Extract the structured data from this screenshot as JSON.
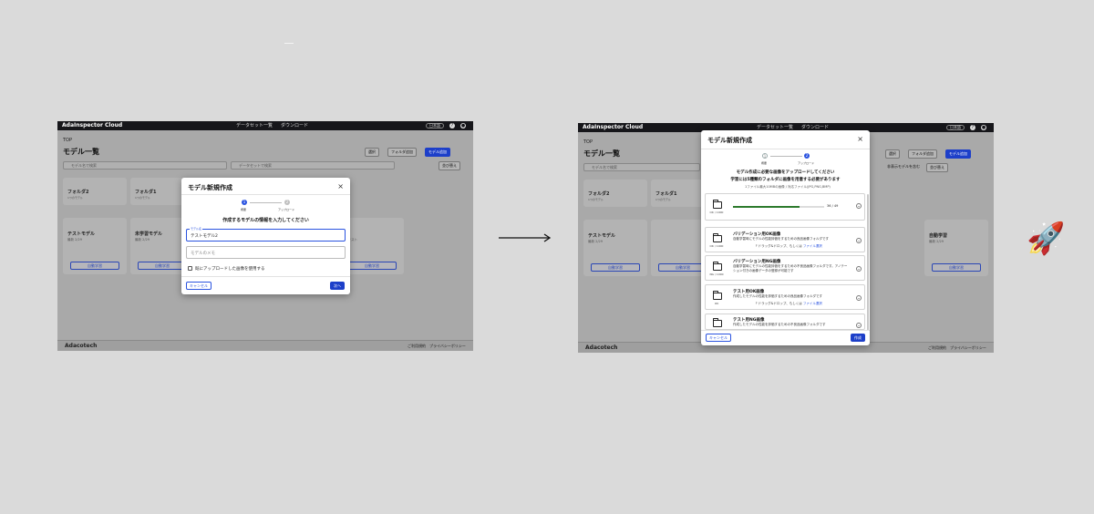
{
  "app": {
    "brand": "AdaInspector Cloud",
    "nav_dataset": "データセット一覧",
    "nav_download": "ダウンロード",
    "language": "日本語",
    "breadcrumb": "TOP",
    "page_title": "モデル一覧",
    "footer_logo": "Adacotech",
    "footer_links": [
      "ご利用規約",
      "プライバシーポリシー"
    ]
  },
  "toolbar": {
    "select": "選択",
    "add_folder": "フォルダ追加",
    "add_model": "モデル追加",
    "search_model": "モデル名で検索",
    "search_dataset": "データセットで検索",
    "show_hidden": "非表示モデルを含む",
    "sort": "並び替え"
  },
  "folders": [
    {
      "name": "フォルダ2",
      "sub": "1つのモデル"
    },
    {
      "name": "フォルダ1",
      "sub": "1つのモデル"
    },
    {
      "name": "",
      "sub": ""
    },
    {
      "name": "",
      "sub": ""
    }
  ],
  "models": [
    {
      "name": "テストモデル",
      "sub": "最新 2/29",
      "button": "自動学習"
    },
    {
      "name": "未学習モデル",
      "sub": "最新 2/29",
      "button": "自動学習"
    },
    {
      "name": "",
      "sub": "",
      "button": "自動学習"
    },
    {
      "name": "",
      "sub": "のテスト",
      "button": "自動学習"
    }
  ],
  "models_right": [
    {
      "name": "テストモデル",
      "sub": "最新 2/29",
      "button": "自動学習"
    },
    {
      "name": "",
      "sub": "",
      "button": "自動学習"
    },
    {
      "name": "",
      "sub": "",
      "button": "自動学習"
    },
    {
      "name": "",
      "sub": "",
      "button": "自動学習"
    },
    {
      "name": "",
      "sub": "",
      "button": "自動学習"
    },
    {
      "name": "自動学習",
      "sub": "最新 2/29",
      "button": "自動学習"
    }
  ],
  "dialog1": {
    "title": "モデル新規作成",
    "step1": "概要",
    "step2": "アップロード",
    "message": "作成するモデルの情報を入力してください",
    "name_label": "モデル名",
    "name_value": "テストモデル2",
    "memo_placeholder": "モデルのメモ",
    "checkbox_label": "既にアップロードした画像を使用する",
    "cancel": "キャンセル",
    "next": "次へ"
  },
  "dialog2": {
    "title": "モデル新規作成",
    "step1": "概要",
    "step2": "アップロード",
    "line1": "モデル作成に必要な画像をアップロードしてください",
    "line2": "学習には5種類のフォルダに画像を用意する必要があります",
    "sub": "1ファイル最大10MBの画像 / 対応ファイル(JPG,PNG,BMP)",
    "progress_label": "36 / 49",
    "progress_value": 0.73,
    "cards": [
      {
        "count": "OK / 1000",
        "title": "",
        "desc": "",
        "drop": "",
        "link": ""
      },
      {
        "count": "OK / 1000",
        "title": "バリデーション用OK画像",
        "desc": "自動学習時にモデルの性能評価をするための良品画像フォルダです",
        "drop": "ドラッグ&ドロップ、もしくは",
        "link": "ファイル選択"
      },
      {
        "count": "NG / 1000",
        "title": "バリデーション用NG画像",
        "desc": "自動学習時にモデルの性能評価をするための不良品画像フォルダです。アノテーション付きの画像データの登録が可能です",
        "drop": "ドラッグ&ドロップ、もしくは",
        "link": "ファイル選択"
      },
      {
        "count": "OK",
        "title": "テスト用OK画像",
        "desc": "作成したモデルの性能を評価するための良品画像フォルダです",
        "drop": "ドラッグ&ドロップ、もしくは",
        "link": "ファイル選択"
      },
      {
        "count": "",
        "title": "テスト用NG画像",
        "desc": "作成したモデルの性能を評価するための不良品画像フォルダです",
        "drop": "",
        "link": ""
      }
    ],
    "cancel": "キャンセル",
    "create": "作成"
  },
  "colors": {
    "accent": "#2a53e0",
    "primary_button": "#1d3fc9",
    "progress": "#2c7a2c",
    "topbar": "#16161a"
  },
  "icons": {
    "arrow": "right-arrow-icon",
    "rocket": "🚀"
  }
}
